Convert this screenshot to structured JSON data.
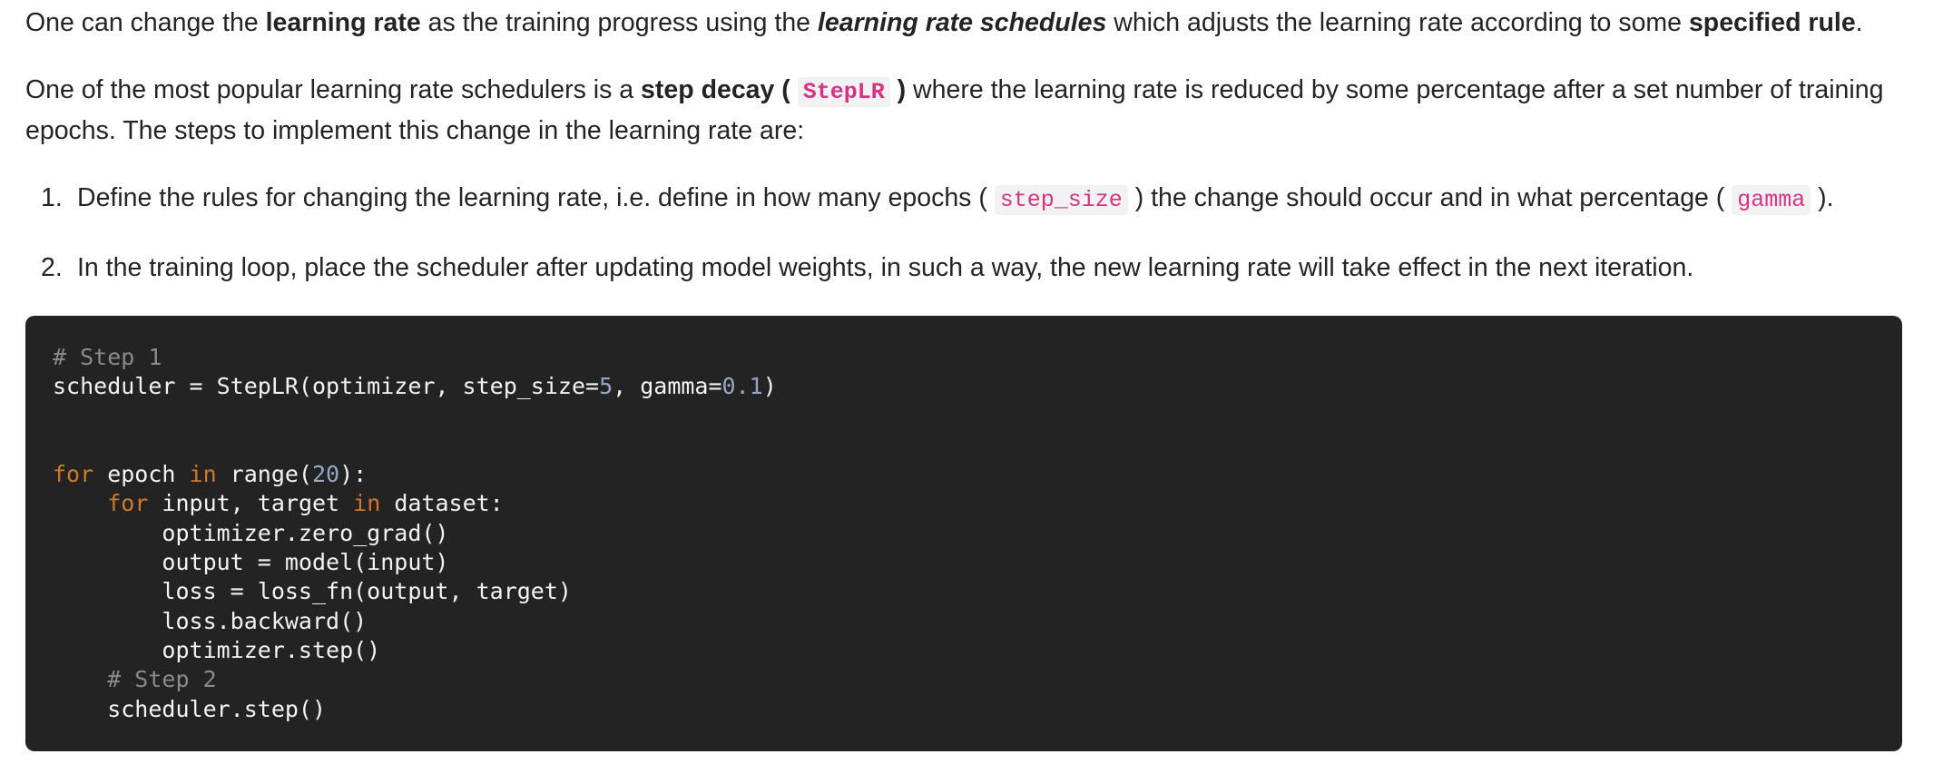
{
  "para1": {
    "t1": "One can change the ",
    "b1": "learning rate",
    "t2": " as the training progress using the ",
    "bi1": "learning rate schedules",
    "t3": " which adjusts the learning rate according to some ",
    "b2": "specified rule",
    "t4": "."
  },
  "para2": {
    "t1": "One of the most popular learning rate schedulers is a ",
    "b1": "step decay ( ",
    "code1": "StepLR",
    "b2": " )",
    "t2": " where the learning rate is reduced by some percentage after a set number of training epochs. The steps to implement this change in the learning rate are:"
  },
  "steps": [
    {
      "num": "1.",
      "t1": "Define the rules for changing the learning rate, i.e. define in how many epochs ( ",
      "code1": "step_size",
      "t2": " ) the change should occur and in what percentage ( ",
      "code2": "gamma",
      "t3": " )."
    },
    {
      "num": "2.",
      "t1": "In the training loop, place the scheduler after updating model weights, in such a way, the new learning rate will take effect in the next iteration."
    }
  ],
  "code": {
    "comment1": "# Step 1",
    "line2a": "scheduler = StepLR(optimizer, step_size=",
    "num5": "5",
    "line2b": ", gamma=",
    "num01": "0.1",
    "line2c": ")",
    "kw_for": "for",
    "l5a": " epoch ",
    "kw_in": "in",
    "l5b": " range(",
    "num20": "20",
    "l5c": "):",
    "l6indent": "    ",
    "l6a": " input, target ",
    "l6b": " dataset:",
    "l7": "        optimizer.zero_grad()",
    "l8": "        output = model(input)",
    "l9": "        loss = loss_fn(output, target)",
    "l10": "        loss.backward()",
    "l11": "        optimizer.step()",
    "comment2": "    # Step 2",
    "l13": "    scheduler.step()"
  }
}
